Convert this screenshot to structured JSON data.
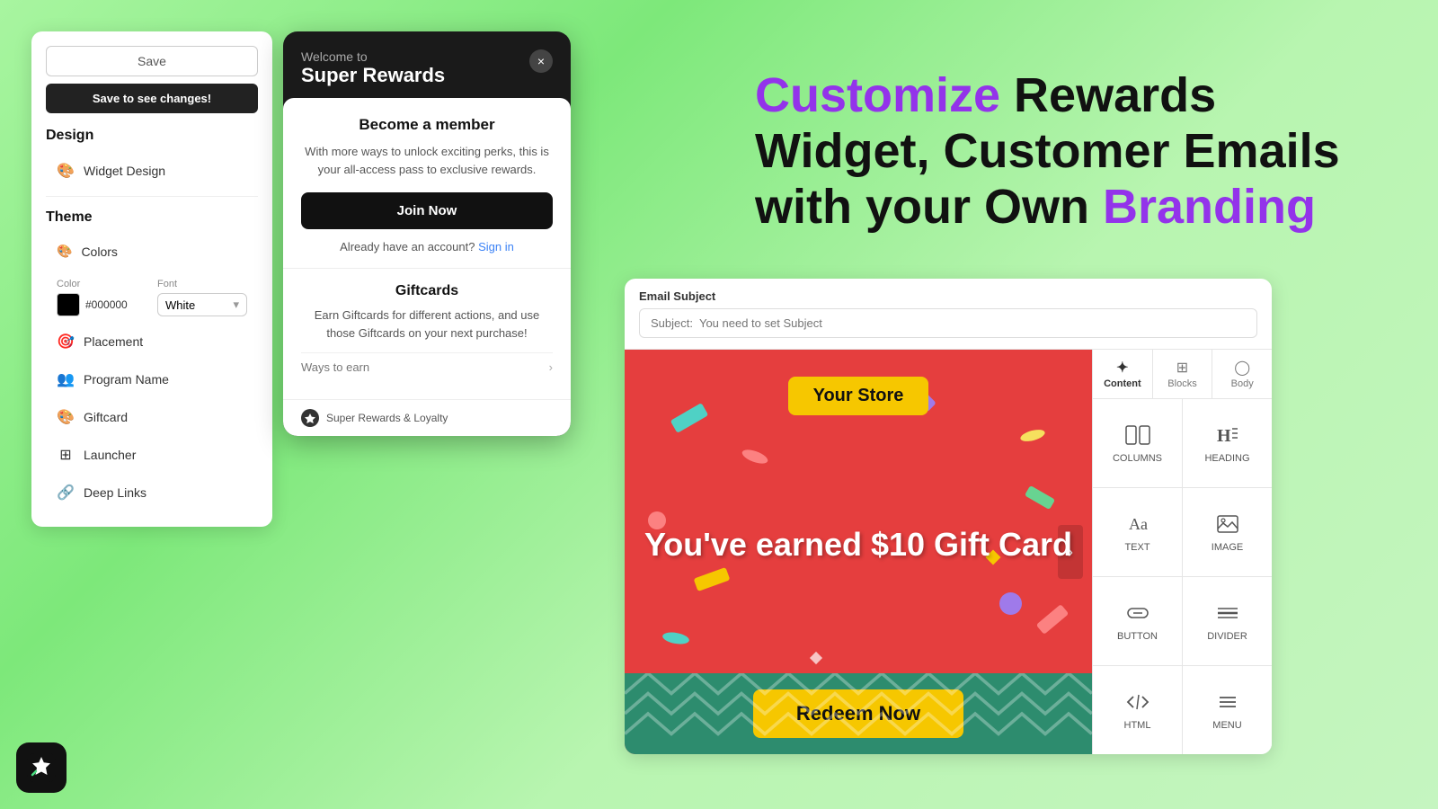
{
  "leftPanel": {
    "saveLabel": "Save",
    "saveChangesLabel": "Save to see changes!",
    "design": {
      "title": "Design",
      "items": [
        {
          "label": "Widget Design",
          "icon": "🎨"
        }
      ]
    },
    "theme": {
      "title": "Theme",
      "items": [
        {
          "label": "Colors",
          "icon": "🎨"
        },
        {
          "label": "Placement",
          "icon": "🎯"
        },
        {
          "label": "Program Name",
          "icon": "👥"
        },
        {
          "label": "Giftcard",
          "icon": "🎨"
        },
        {
          "label": "Launcher",
          "icon": "⊞"
        },
        {
          "label": "Deep Links",
          "icon": "🔗"
        }
      ]
    },
    "colorSection": {
      "colorLabel": "Color",
      "colorHex": "#000000",
      "fontLabel": "Font",
      "fontValue": "White"
    }
  },
  "widgetModal": {
    "welcomeSmall": "Welcome to",
    "welcomeLarge": "Super Rewards",
    "closeButton": "×",
    "becomeTitle": "Become a member",
    "becomeDesc": "With more ways to unlock exciting perks, this is your all-access pass to exclusive rewards.",
    "joinButton": "Join Now",
    "alreadyText": "Already have an account?",
    "signInLink": "Sign in",
    "giftcardsTitle": "Giftcards",
    "giftcardsDesc": "Earn Giftcards for different actions, and use those Giftcards on your next purchase!",
    "waysToEarn": "Ways to earn",
    "footerBrand": "Super Rewards & Loyalty"
  },
  "headline": {
    "line1": "Customize",
    "line1Suffix": " Rewards",
    "line2": "Widget, Customer Emails",
    "line3Prefix": "with your Own ",
    "line3Accent": "Branding"
  },
  "emailEditor": {
    "subjectBarLabel": "Email Subject",
    "subjectPlaceholder": "Subject:  You need to set Subject",
    "giftCard": {
      "storeName": "Your Store",
      "earnedText": "You've earned $10 Gift Card",
      "redeemButton": "Redeem Now"
    },
    "sidebar": {
      "tabs": [
        {
          "label": "Content",
          "icon": "✦"
        },
        {
          "label": "Blocks",
          "icon": "⊞"
        },
        {
          "label": "Body",
          "icon": "◯"
        }
      ],
      "tools": [
        {
          "label": "COLUMNS",
          "icon": "columns"
        },
        {
          "label": "HEADING",
          "icon": "heading"
        },
        {
          "label": "TEXT",
          "icon": "text"
        },
        {
          "label": "IMAGE",
          "icon": "image"
        },
        {
          "label": "BUTTON",
          "icon": "button"
        },
        {
          "label": "DIVIDER",
          "icon": "divider"
        },
        {
          "label": "HTML",
          "icon": "html"
        },
        {
          "label": "MENU",
          "icon": "menu"
        }
      ]
    }
  },
  "brand": {
    "icon": "S"
  }
}
